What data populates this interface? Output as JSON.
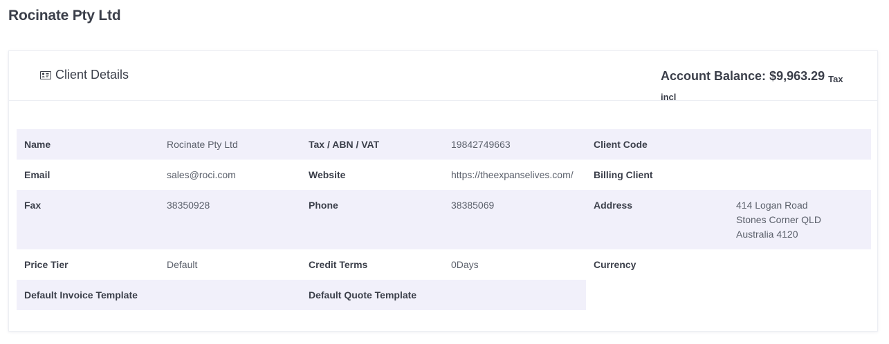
{
  "page": {
    "title": "Rocinate Pty Ltd"
  },
  "card": {
    "title": "Client Details",
    "icon": "id-card-icon",
    "balance_label": "Account Balance:",
    "balance_value": "$9,963.29",
    "balance_suffix_1": "Tax",
    "balance_suffix_2": "incl"
  },
  "details": {
    "name_label": "Name",
    "name_value": "Rocinate Pty Ltd",
    "tax_label": "Tax / ABN / VAT",
    "tax_value": "19842749663",
    "client_code_label": "Client Code",
    "client_code_value": "",
    "email_label": "Email",
    "email_value": "sales@roci.com",
    "website_label": "Website",
    "website_value": "https://theexpanselives.com/",
    "billing_client_label": "Billing Client",
    "billing_client_value": "",
    "fax_label": "Fax",
    "fax_value": "38350928",
    "phone_label": "Phone",
    "phone_value": "38385069",
    "address_label": "Address",
    "address_lines": [
      "414 Logan Road",
      "Stones Corner QLD",
      "Australia 4120"
    ],
    "price_tier_label": "Price Tier",
    "price_tier_value": "Default",
    "credit_terms_label": "Credit Terms",
    "credit_terms_value": "0Days",
    "currency_label": "Currency",
    "currency_value": "",
    "invoice_template_label": "Default Invoice Template",
    "invoice_template_value": "",
    "quote_template_label": "Default Quote Template",
    "quote_template_value": ""
  },
  "colors": {
    "row_shade": "#f1f0fa",
    "text": "#3b3f4a",
    "muted_text": "#5b606b"
  }
}
